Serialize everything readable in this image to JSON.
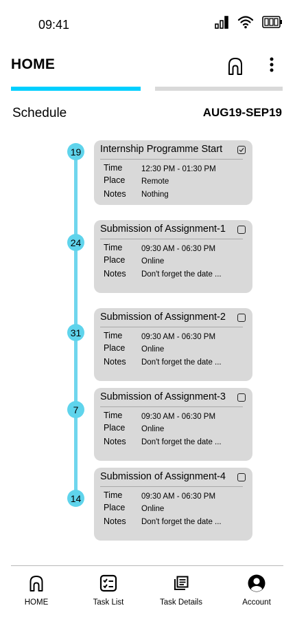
{
  "status_bar": {
    "time": "09:41"
  },
  "header": {
    "title": "HOME",
    "home_icon": "home-icon",
    "more_icon": "more-vertical-icon"
  },
  "tabs": {
    "active_color": "#00cfff",
    "inactive_color": "#d9d9d9"
  },
  "schedule": {
    "label": "Schedule",
    "range": "AUG19-SEP19"
  },
  "field_labels": {
    "time": "Time",
    "place": "Place",
    "notes": "Notes"
  },
  "events": [
    {
      "day": "19",
      "title": "Internship Programme Start",
      "checked": true,
      "time": "12:30 PM - 01:30 PM",
      "place": "Remote",
      "notes": "Nothing"
    },
    {
      "day": "24",
      "title": "Submission of Assignment-1",
      "checked": false,
      "time": "09:30 AM - 06:30 PM",
      "place": "Online",
      "notes": "Don't forget the date ..."
    },
    {
      "day": "31",
      "title": "Submission of Assignment-2",
      "checked": false,
      "time": "09:30 AM - 06:30 PM",
      "place": "Online",
      "notes": "Don't forget the date ..."
    },
    {
      "day": "7",
      "title": "Submission of Assignment-3",
      "checked": false,
      "time": "09:30 AM - 06:30 PM",
      "place": "Online",
      "notes": "Don't forget the date ..."
    },
    {
      "day": "14",
      "title": "Submission of Assignment-4",
      "checked": false,
      "time": "09:30 AM - 06:30 PM",
      "place": "Online",
      "notes": "Don't forget the date ..."
    }
  ],
  "colors": {
    "accent": "#00cfff",
    "timeline": "#6fd6ed",
    "card": "#d9d9d9"
  },
  "bottom_nav": [
    {
      "label": "HOME",
      "icon": "home-icon"
    },
    {
      "label": "Task List",
      "icon": "task-list-icon"
    },
    {
      "label": "Task Details",
      "icon": "task-details-icon"
    },
    {
      "label": "Account",
      "icon": "account-icon"
    }
  ]
}
